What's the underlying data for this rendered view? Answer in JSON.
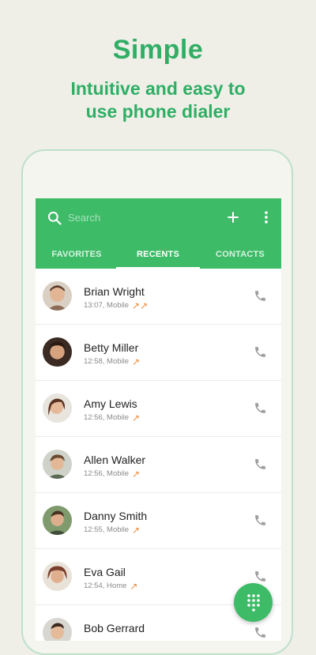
{
  "promo": {
    "headline": "Simple",
    "subhead_line1": "Intuitive and easy to",
    "subhead_line2": "use phone dialer"
  },
  "appbar": {
    "search_placeholder": "Search",
    "add_icon": "plus-icon",
    "more_icon": "more-vert-icon"
  },
  "tabs": [
    {
      "label": "FAVORITES",
      "active": false
    },
    {
      "label": "RECENTS",
      "active": true
    },
    {
      "label": "CONTACTS",
      "active": false
    }
  ],
  "recents": [
    {
      "name": "Brian Wright",
      "time": "13:07, Mobile",
      "arrows": "↗↗"
    },
    {
      "name": "Betty Miller",
      "time": "12:58, Mobile",
      "arrows": "↗"
    },
    {
      "name": "Amy Lewis",
      "time": "12:56, Mobile",
      "arrows": "↗"
    },
    {
      "name": "Allen Walker",
      "time": "12:56, Mobile",
      "arrows": "↗"
    },
    {
      "name": "Danny Smith",
      "time": "12:55, Mobile",
      "arrows": "↗"
    },
    {
      "name": "Eva Gail",
      "time": "12:54, Home",
      "arrows": "↗"
    },
    {
      "name": "Bob Gerrard",
      "time": "",
      "arrows": ""
    }
  ],
  "colors": {
    "accent": "#3dbb67",
    "headline_green": "#2fae64",
    "outgoing_arrow": "#f08c3c",
    "background": "#efefe8"
  },
  "fab_icon": "dialpad-icon"
}
